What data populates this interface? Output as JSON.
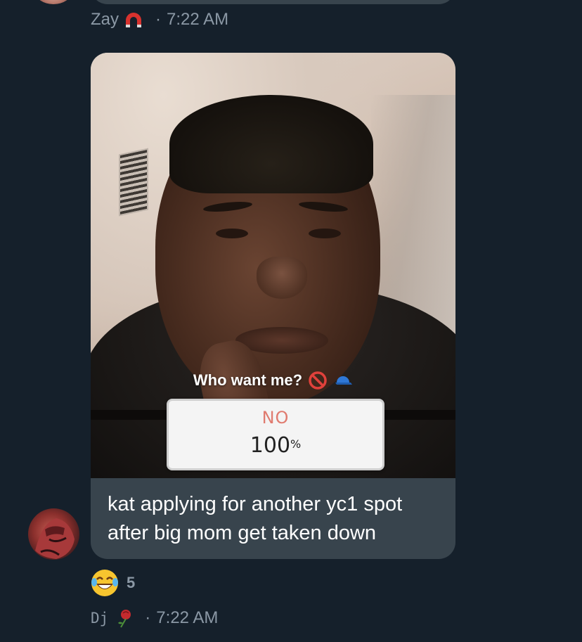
{
  "previous_message": {
    "sender_name": "Zay",
    "time": "7:22 AM"
  },
  "message": {
    "image": {
      "poll_question": "Who want me?",
      "poll_option": "NO",
      "poll_percent": "100",
      "poll_percent_unit": "%"
    },
    "text": "kat applying for another yc1 spot after big mom get taken down",
    "reaction": {
      "emoji": "laughing-emoji",
      "count": "5"
    },
    "sender_name": "Dj",
    "time": "7:22 AM"
  },
  "colors": {
    "background": "#15202b",
    "bubble": "#38444d",
    "meta_text": "#8b98a5",
    "message_text": "#ffffff"
  },
  "icons": [
    "magnet-icon",
    "no-entry-icon",
    "cap-icon",
    "laughing-icon",
    "rose-icon"
  ]
}
